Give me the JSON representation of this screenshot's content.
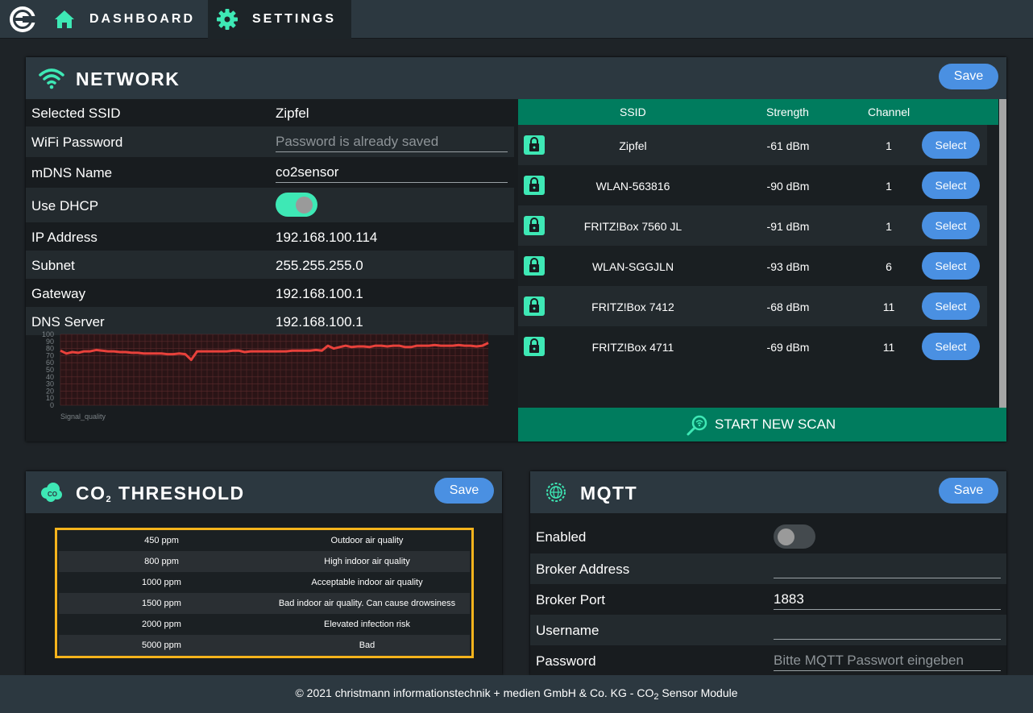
{
  "nav": {
    "dashboard": "DASHBOARD",
    "settings": "SETTINGS"
  },
  "network": {
    "title": "NETWORK",
    "save": "Save",
    "fields": {
      "ssid_label": "Selected SSID",
      "ssid_value": "Zipfel",
      "password_label": "WiFi Password",
      "password_placeholder": "Password is already saved",
      "mdns_label": "mDNS Name",
      "mdns_value": "co2sensor",
      "dhcp_label": "Use DHCP",
      "dhcp_on": true,
      "ip_label": "IP Address",
      "ip_value": "192.168.100.114",
      "subnet_label": "Subnet",
      "subnet_value": "255.255.255.0",
      "gateway_label": "Gateway",
      "gateway_value": "192.168.100.1",
      "dns_label": "DNS Server",
      "dns_value": "192.168.100.1"
    },
    "scan": {
      "headers": {
        "ssid": "SSID",
        "strength": "Strength",
        "channel": "Channel"
      },
      "select_label": "Select",
      "rows": [
        {
          "ssid": "Zipfel",
          "strength": "-61 dBm",
          "channel": "1"
        },
        {
          "ssid": "WLAN-563816",
          "strength": "-90 dBm",
          "channel": "1"
        },
        {
          "ssid": "FRITZ!Box 7560 JL",
          "strength": "-91 dBm",
          "channel": "1"
        },
        {
          "ssid": "WLAN-SGGJLN",
          "strength": "-93 dBm",
          "channel": "6"
        },
        {
          "ssid": "FRITZ!Box 7412",
          "strength": "-68 dBm",
          "channel": "11"
        },
        {
          "ssid": "FRITZ!Box 4711",
          "strength": "-69 dBm",
          "channel": "11"
        }
      ],
      "start_scan": "START NEW SCAN"
    }
  },
  "chart_data": {
    "type": "line",
    "xlabel": "Signal_quality",
    "ylim": [
      0,
      100
    ],
    "yticks": [
      "100",
      "90",
      "80",
      "70",
      "60",
      "50",
      "40",
      "30",
      "20",
      "10",
      "0"
    ],
    "series": [
      {
        "values": [
          77,
          73,
          75,
          74,
          76,
          76,
          78,
          77,
          76,
          76,
          75,
          75,
          74,
          74,
          73,
          73,
          73,
          73,
          72,
          72,
          73,
          72,
          64,
          76,
          76,
          76,
          76,
          76,
          76,
          77,
          77,
          75,
          76,
          76,
          76,
          76,
          76,
          76,
          76,
          77,
          77,
          77,
          77,
          78,
          77,
          84,
          80,
          82,
          84,
          82,
          83,
          83,
          82,
          84,
          84,
          83,
          84,
          84,
          82,
          82,
          84,
          84,
          84,
          85,
          84,
          84,
          84,
          85,
          84,
          84,
          83,
          84,
          88
        ]
      }
    ],
    "color": "#e8413b"
  },
  "co2": {
    "title_pre": "CO",
    "title_sub": "2",
    "title_post": "THRESHOLD",
    "save": "Save",
    "rows": [
      {
        "ppm": "450 ppm",
        "desc": "Outdoor air quality"
      },
      {
        "ppm": "800 ppm",
        "desc": "High indoor air quality"
      },
      {
        "ppm": "1000 ppm",
        "desc": "Acceptable indoor air quality"
      },
      {
        "ppm": "1500 ppm",
        "desc": "Bad indoor air quality. Can cause drowsiness"
      },
      {
        "ppm": "2000 ppm",
        "desc": "Elevated infection risk"
      },
      {
        "ppm": "5000 ppm",
        "desc": "Bad"
      }
    ]
  },
  "mqtt": {
    "title": "MQTT",
    "save": "Save",
    "enabled_label": "Enabled",
    "enabled_on": false,
    "broker_address_label": "Broker Address",
    "broker_address_value": "",
    "broker_port_label": "Broker Port",
    "broker_port_value": "1883",
    "username_label": "Username",
    "username_value": "",
    "password_label": "Password",
    "password_placeholder": "Bitte MQTT Passwort eingeben"
  },
  "footer": {
    "pre": "© 2021 christmann informationstechnik + medien GmbH & Co. KG - CO",
    "sub": "2",
    "post": " Sensor Module"
  },
  "colors": {
    "accent": "#3ee8b5",
    "button": "#4a90e2",
    "header": "#2c3840",
    "scan_green": "#007c5e",
    "threshold_border": "#f5b31c"
  }
}
